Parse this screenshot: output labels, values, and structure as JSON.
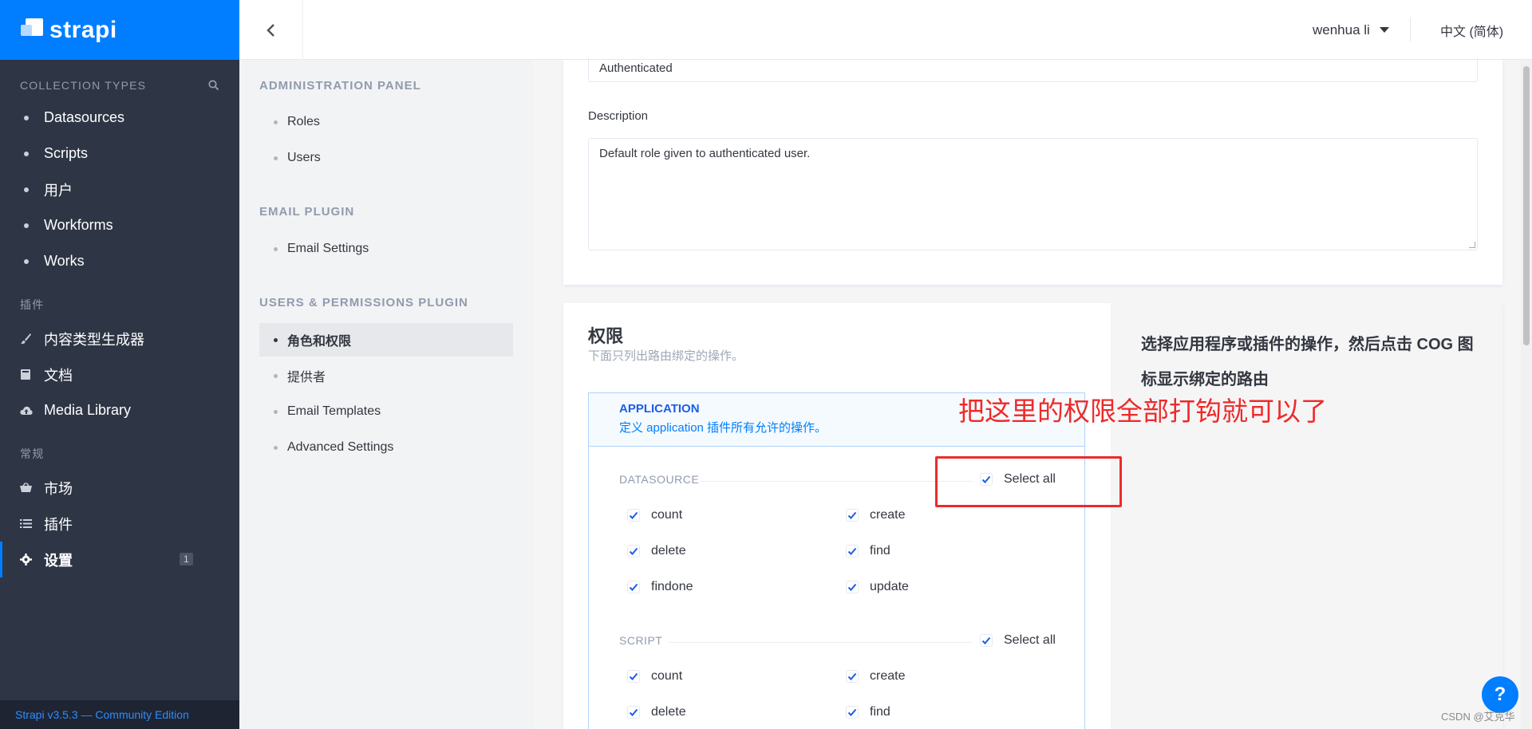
{
  "brand": {
    "logo_text": "strapi"
  },
  "leftnav": {
    "collection_title": "COLLECTION TYPES",
    "collections": [
      "Datasources",
      "Scripts",
      "用户",
      "Workforms",
      "Works"
    ],
    "plugins_title": "插件",
    "plugins": [
      {
        "label": "内容类型生成器",
        "icon": "paintbrush-icon"
      },
      {
        "label": "文档",
        "icon": "book-icon"
      },
      {
        "label": "Media Library",
        "icon": "cloud-upload-icon"
      }
    ],
    "general_title": "常规",
    "general": [
      {
        "label": "市场",
        "icon": "basket-icon"
      },
      {
        "label": "插件",
        "icon": "list-icon"
      },
      {
        "label": "设置",
        "icon": "gear-icon",
        "badge": "1"
      }
    ],
    "footer": "Strapi v3.5.3 — Community Edition"
  },
  "topbar": {
    "user": "wenhua li",
    "lang": "中文 (简体)"
  },
  "subnav": {
    "admin_title": "ADMINISTRATION PANEL",
    "admin_items": [
      "Roles",
      "Users"
    ],
    "email_title": "EMAIL PLUGIN",
    "email_items": [
      "Email Settings"
    ],
    "up_title": "USERS & PERMISSIONS PLUGIN",
    "up_items": [
      "角色和权限",
      "提供者",
      "Email Templates",
      "Advanced Settings"
    ]
  },
  "role": {
    "name_value": "Authenticated",
    "description_label": "Description",
    "description_value": "Default role given to authenticated user."
  },
  "permissions": {
    "title": "权限",
    "subtitle": "下面只列出路由绑定的操作。",
    "app_title": "APPLICATION",
    "app_desc": "定义 application 插件所有允许的操作。",
    "select_all": "Select all",
    "groups": [
      {
        "name": "DATASOURCE",
        "actions": [
          "count",
          "create",
          "delete",
          "find",
          "findone",
          "update"
        ]
      },
      {
        "name": "SCRIPT",
        "actions": [
          "count",
          "create",
          "delete",
          "find"
        ]
      }
    ],
    "help": "选择应用程序或插件的操作，然后点击 COG 图标显示绑定的路由"
  },
  "annotation": {
    "text": "把这里的权限全部打钩就可以了"
  },
  "watermark": "CSDN @艾克华",
  "colors": {
    "brand": "#007eff",
    "sidebar": "#2e3545",
    "annotation": "#ee2a2a"
  }
}
